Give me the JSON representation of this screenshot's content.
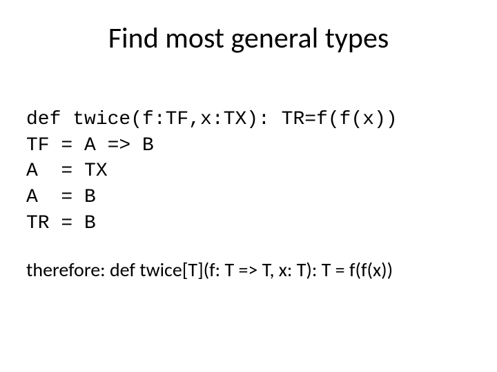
{
  "title": "Find most general types",
  "code": {
    "line1": "def twice(f:TF,x:TX): TR=f(f(x))",
    "line2": "TF = A => B",
    "line3": "A  = TX",
    "line4": "A  = B",
    "line5": "TR = B"
  },
  "conclusion": "therefore: def twice[T](f: T => T, x: T): T = f(f(x))"
}
